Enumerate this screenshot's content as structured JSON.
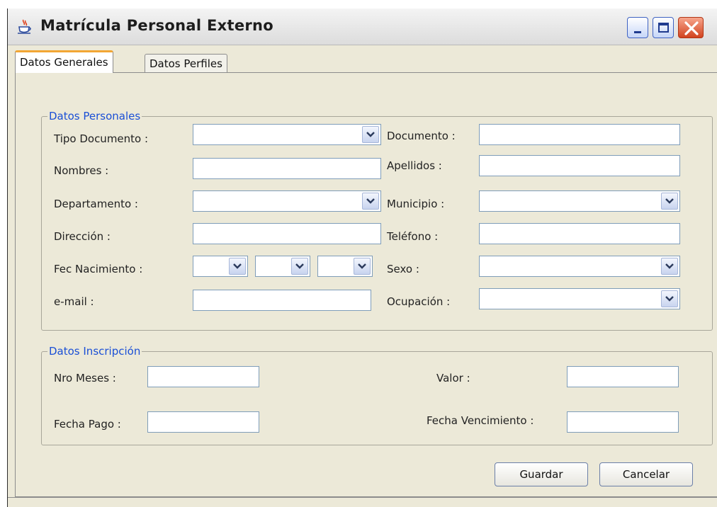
{
  "window": {
    "title": "Matrícula Personal Externo",
    "icon": "java-coffee-cup-icon",
    "controls": [
      "minimize-icon",
      "maximize-icon",
      "close-icon"
    ]
  },
  "tabs": [
    {
      "label": "Datos Generales",
      "selected": true
    },
    {
      "label": "Datos Perfiles",
      "selected": false
    }
  ],
  "datos_personales": {
    "legend": "Datos Personales",
    "tipo_documento": {
      "label": "Tipo Documento :",
      "value": ""
    },
    "documento": {
      "label": "Documento :",
      "value": ""
    },
    "nombres": {
      "label": "Nombres :",
      "value": ""
    },
    "apellidos": {
      "label": "Apellidos :",
      "value": ""
    },
    "departamento": {
      "label": "Departamento :",
      "value": ""
    },
    "municipio": {
      "label": "Municipio :",
      "value": ""
    },
    "direccion": {
      "label": "Dirección :",
      "value": ""
    },
    "telefono": {
      "label": "Teléfono :",
      "value": ""
    },
    "fec_nacimiento": {
      "label": "Fec Nacimiento :",
      "day": "",
      "month": "",
      "year": ""
    },
    "sexo": {
      "label": "Sexo :",
      "value": ""
    },
    "email": {
      "label": "e-mail :",
      "value": ""
    },
    "ocupacion": {
      "label": "Ocupación :",
      "value": ""
    }
  },
  "datos_inscripcion": {
    "legend": "Datos Inscripción",
    "nro_meses": {
      "label": "Nro Meses :",
      "value": ""
    },
    "valor": {
      "label": "Valor :",
      "value": ""
    },
    "fecha_pago": {
      "label": "Fecha Pago :",
      "value": ""
    },
    "fecha_vencimiento": {
      "label": "Fecha Vencimiento :",
      "value": ""
    }
  },
  "buttons": {
    "guardar": "Guardar",
    "cancelar": "Cancelar"
  },
  "colors": {
    "legend_text": "#1a4fd6",
    "window_background": "#ece9d8",
    "active_tab_accent": "#f2a634",
    "close_button": "#d2431f"
  }
}
